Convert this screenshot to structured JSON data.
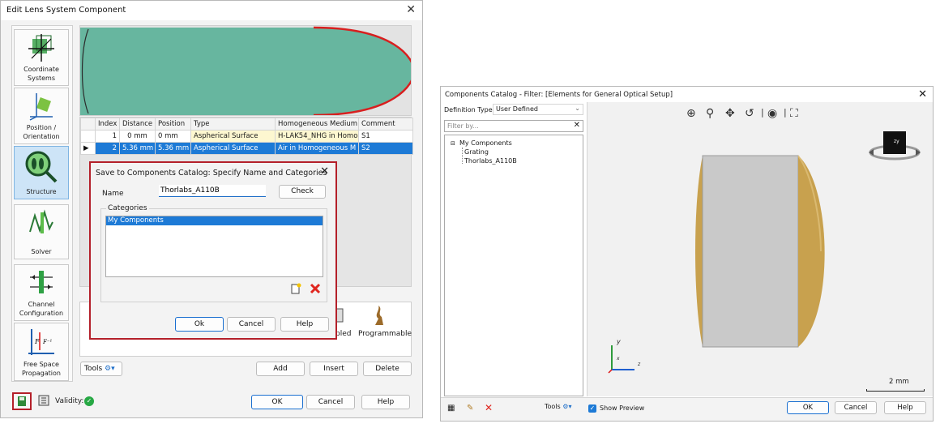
{
  "left_window": {
    "title": "Edit Lens System Component",
    "side_buttons": [
      {
        "label": "Coordinate Systems",
        "icon": "coordinate-systems-icon"
      },
      {
        "label": "Position / Orientation",
        "icon": "position-orientation-icon"
      },
      {
        "label": "Structure",
        "icon": "structure-icon"
      },
      {
        "label": "Solver",
        "icon": "solver-icon"
      },
      {
        "label": "Channel Configuration",
        "icon": "channel-configuration-icon"
      },
      {
        "label": "Free Space Propagation",
        "icon": "free-space-propagation-icon"
      }
    ],
    "table": {
      "headers": [
        "Index",
        "Distance",
        "Position",
        "Type",
        "Homogeneous Medium",
        "Comment"
      ],
      "rows": [
        [
          "1",
          "0 mm",
          "0 mm",
          "Aspherical Surface",
          "H-LAK54_NHG in Homo",
          "S1"
        ],
        [
          "2",
          "5.36 mm",
          "5.36 mm",
          "Aspherical Surface",
          "Air in Homogeneous M",
          "S2"
        ]
      ],
      "selected_row": 2
    },
    "hidden_options": [
      "pled",
      "Programmable"
    ],
    "tools_label": "Tools",
    "add_label": "Add",
    "insert_label": "Insert",
    "delete_label": "Delete",
    "validity_label": "Validity:",
    "ok_label": "OK",
    "cancel_label": "Cancel",
    "help_label": "Help"
  },
  "save_dialog": {
    "title": "Save to Components Catalog: Specify Name and Categories",
    "name_label": "Name",
    "name_value": "Thorlabs_A110B",
    "check_label": "Check",
    "categories_label": "Categories",
    "categories": [
      "My Components"
    ],
    "ok_label": "Ok",
    "cancel_label": "Cancel",
    "help_label": "Help"
  },
  "catalog_window": {
    "title": "Components Catalog - Filter: [Elements for General Optical Setup]",
    "definition_type_label": "Definition Type",
    "definition_type_value": "User Defined",
    "filter_placeholder": "Filter by...",
    "tree": {
      "root": "My Components",
      "children": [
        "Grating",
        "Thorlabs_A110B"
      ]
    },
    "view_cube_label": "zy",
    "axis_y": "y",
    "axis_z": "z",
    "axis_x": "x",
    "scale_label": "2 mm",
    "tools_label": "Tools",
    "show_preview_label": "Show Preview",
    "show_preview_checked": true,
    "ok_label": "OK",
    "cancel_label": "Cancel",
    "help_label": "Help"
  },
  "colors": {
    "lens_fill": "#67b69f",
    "lens_edge": "#d81f1f",
    "selected_row": "#1d7ad6",
    "lens_body": "#c9c9c9",
    "lens_cap": "#c8a14e",
    "highlight_frame": "#b4202a",
    "validity_ok": "#27a844"
  }
}
